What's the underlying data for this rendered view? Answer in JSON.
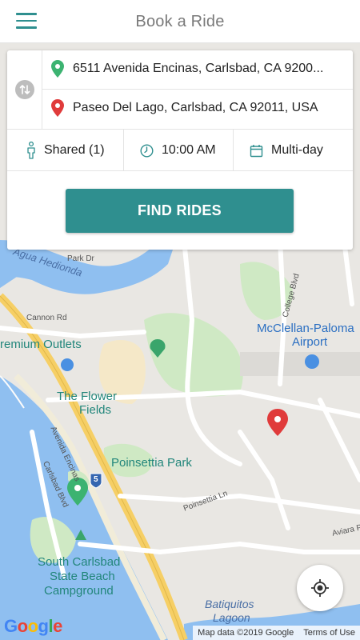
{
  "header": {
    "title": "Book a Ride",
    "menu_icon": "hamburger-menu-icon"
  },
  "booking": {
    "pickup_address": "6511 Avenida Encinas, Carlsbad, CA 9200...",
    "dropoff_address": "Paseo Del Lago, Carlsbad, CA 92011, USA",
    "ride_type": "Shared (1)",
    "time": "10:00 AM",
    "schedule": "Multi-day",
    "find_button": "FIND RIDES",
    "pickup_pin_color": "#3cb371",
    "dropoff_pin_color": "#e03b3b",
    "accent_color": "#2f8f8f"
  },
  "map": {
    "labels": {
      "premium_outlets": "remium Outlets",
      "flower_fields_1": "The Flower",
      "flower_fields_2": "Fields",
      "poinsettia_park": "Poinsettia Park",
      "south_carlsbad_1": "South Carlsbad",
      "south_carlsbad_2": "State Beach",
      "south_carlsbad_3": "Campground",
      "mcclellan": "McClellan-Paloma",
      "airport": "Airport",
      "batiquitos_1": "Batiquitos",
      "batiquitos_2": "Lagoon",
      "agua_hedionda": "Agua Hedionda",
      "park_dr": "Park Dr",
      "cannon_rd": "Cannon Rd",
      "college_blvd": "College Blvd",
      "poinsettia_ln": "Poinsettia Ln",
      "aviara": "Aviara P",
      "avenida_encinas": "Avenida Encinas",
      "carlsbad_blvd": "Carlsbad Blvd",
      "interstate": "5"
    },
    "google_logo": "Google",
    "attribution": "Map data ©2019 Google",
    "terms": "Terms of Use",
    "locate_icon": "my-location-icon"
  }
}
